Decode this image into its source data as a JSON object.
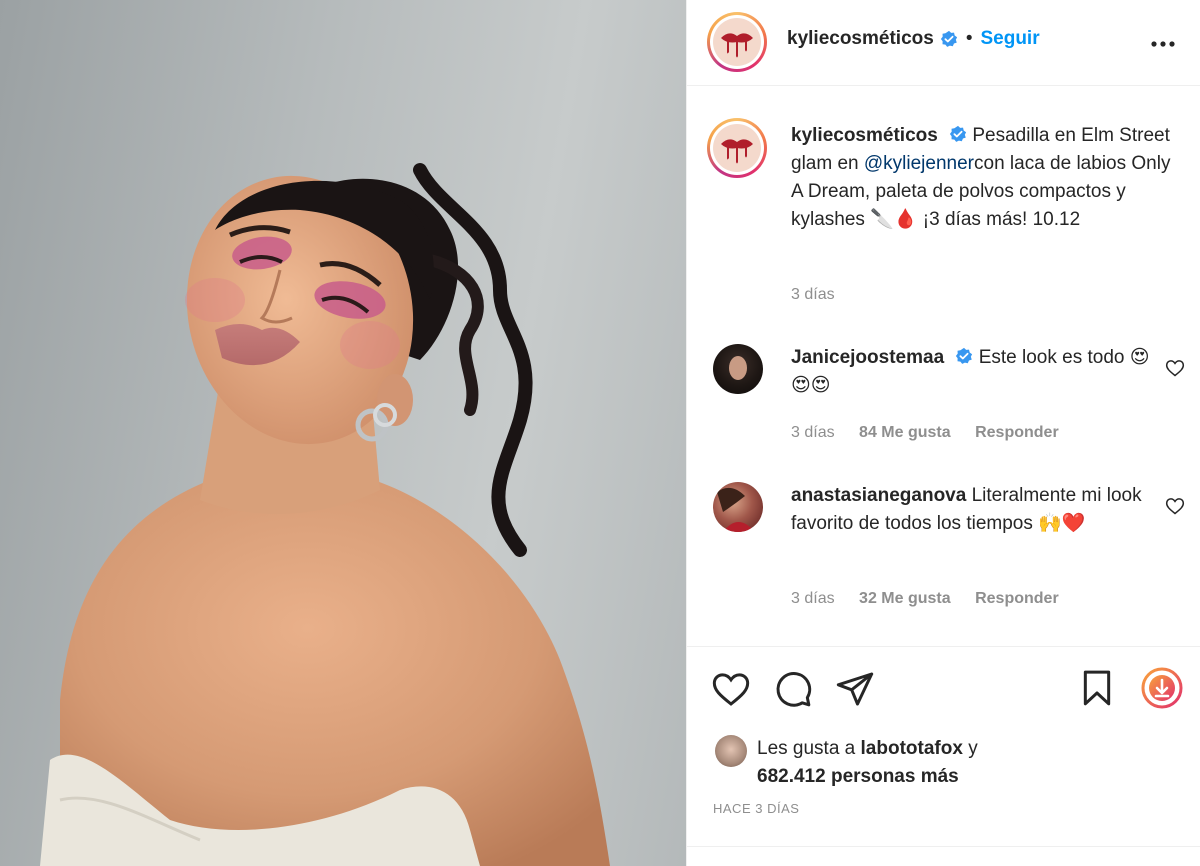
{
  "post": {
    "username": "kyliecosméticos",
    "follow_label": "Seguir",
    "dot": "•",
    "more_label": "•••",
    "caption": {
      "username": "kyliecosméticos",
      "text_before": "Pesadilla en Elm Street glam en ",
      "mention": "@kyliejenner",
      "text_after": "con laca de labios Only A Dream, paleta de polvos compactos y kylashes 🔪🩸 ¡3 días más! 10.12",
      "time": "3 días"
    },
    "comments": [
      {
        "username": "Janicejoostemaa",
        "text": "Este look es todo 😍😍😍",
        "time": "3 días",
        "likes": "84 Me gusta",
        "reply": "Responder"
      },
      {
        "username": "anastasianeganova",
        "text": "Literalmente mi look favorito de todos los tiempos 🙌❤️",
        "time": "3 días",
        "likes": "32 Me gusta",
        "reply": "Responder"
      }
    ],
    "likes": {
      "prefix": "Les gusta a ",
      "user": "labototafox",
      "middle": " y",
      "count": "682.412 personas más"
    },
    "timestamp": "HACE 3 DÍAS"
  },
  "colors": {
    "accent": "#0095f6",
    "text": "#262626",
    "muted": "#8e8e8e",
    "border": "#efefef",
    "mention": "#00376b"
  },
  "icons": [
    "verified-icon",
    "more-options-icon",
    "heart-icon",
    "comment-icon",
    "share-icon",
    "bookmark-icon",
    "download-icon"
  ]
}
